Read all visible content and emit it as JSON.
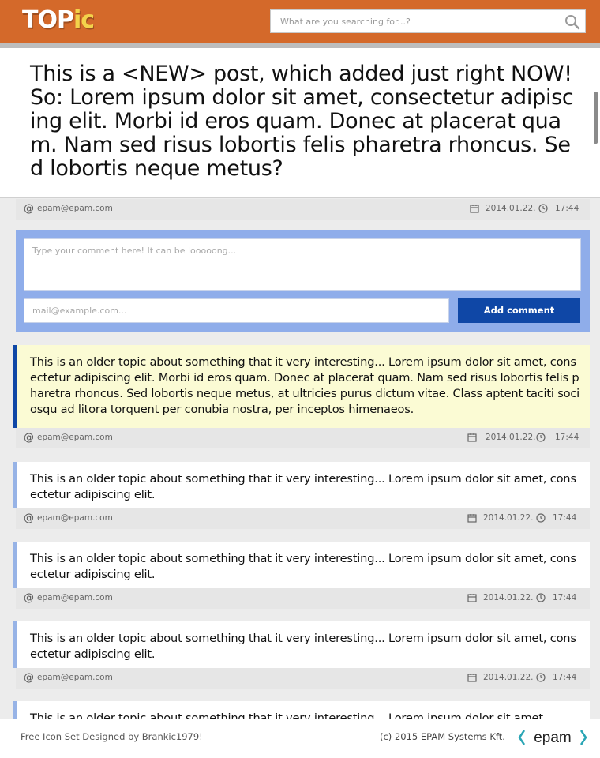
{
  "header": {
    "logo_main": "TOP",
    "logo_accent": "ic",
    "search_placeholder": "What are you searching for...?",
    "colors": {
      "bar": "#d4692a",
      "logo_accent": "#f3d24b"
    },
    "search_icon": "search-icon"
  },
  "new_post": {
    "text": "This is a <NEW> post, which added just right NOW! So: Lorem ipsum dolor sit amet, consectetur adipiscing elit. Morbi id eros quam. Donec at placerat quam. Nam sed risus lobortis felis pharetra rhoncus. Sed lobortis neque metus?",
    "meta": {
      "email": "epam@epam.com",
      "date": "2014.01.22.",
      "time": "17:44"
    }
  },
  "comment_form": {
    "comment_placeholder": "Type your comment here! It can be looooong...",
    "email_placeholder": "mail@example.com...",
    "submit_label": "Add comment",
    "colors": {
      "panel": "#8fadea",
      "button": "#0f47a6"
    }
  },
  "topics": [
    {
      "text": "This is an older topic about something that it very interesting... Lorem ipsum dolor sit amet, consectetur adipiscing elit. Morbi id eros quam. Donec at placerat quam. Nam sed risus lobortis felis pharetra rhoncus. Sed lobortis neque metus, at ultricies purus dictum vitae. Class aptent taciti sociosqu ad litora torquent per conubia nostra, per inceptos himenaeos.",
      "highlighted": true,
      "email": "epam@epam.com",
      "date": "2014.01.22.",
      "time": "17:44"
    },
    {
      "text": "This is an older topic about something that it very interesting... Lorem ipsum dolor sit amet, consectetur adipiscing elit.",
      "highlighted": false,
      "email": "epam@epam.com",
      "date": "2014.01.22.",
      "time": "17:44"
    },
    {
      "text": "This is an older topic about something that it very interesting... Lorem ipsum dolor sit amet, consectetur adipiscing elit.",
      "highlighted": false,
      "email": "epam@epam.com",
      "date": "2014.01.22.",
      "time": "17:44"
    },
    {
      "text": "This is an older topic about something that it very interesting... Lorem ipsum dolor sit amet, consectetur adipiscing elit.",
      "highlighted": false,
      "email": "epam@epam.com",
      "date": "2014.01.22.",
      "time": "17:44"
    },
    {
      "text": "This is an older topic about something that it very interesting... Lorem ipsum dolor sit amet,",
      "highlighted": false
    }
  ],
  "footer": {
    "credit": "Free Icon Set Designed by Brankic1979!",
    "copyright": "(c) 2015 EPAM Systems Kft.",
    "logo_text": "epam"
  }
}
